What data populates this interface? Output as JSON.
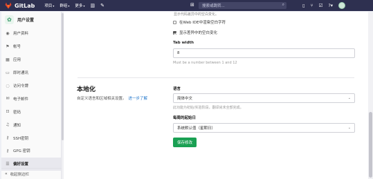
{
  "topbar": {
    "logo_name": "GitLab",
    "nav": [
      {
        "label": "项目",
        "has_caret": true
      },
      {
        "label": "群组",
        "has_caret": true
      },
      {
        "label": "更多",
        "has_caret": true
      }
    ],
    "search_placeholder": "搜索或跳转...",
    "icons": [
      "chart-icon",
      "wrench-icon",
      "plus-icon",
      "search-icon",
      "issues-icon",
      "merge-request-icon",
      "todo-icon",
      "help-icon",
      "avatar"
    ]
  },
  "sidebar": {
    "header": "用户设置",
    "items": [
      {
        "label": "用户资料",
        "icon": "user-icon",
        "active": false
      },
      {
        "label": "帐号",
        "icon": "account-icon",
        "active": false
      },
      {
        "label": "应用",
        "icon": "applications-icon",
        "active": false
      },
      {
        "label": "即时通讯",
        "icon": "chat-icon",
        "active": false
      },
      {
        "label": "访问令牌",
        "icon": "token-icon",
        "active": false
      },
      {
        "label": "电子邮件",
        "icon": "email-icon",
        "active": false
      },
      {
        "label": "密码",
        "icon": "lock-icon",
        "active": false
      },
      {
        "label": "通知",
        "icon": "bell-icon",
        "active": false
      },
      {
        "label": "SSH密钥",
        "icon": "key-icon",
        "active": false
      },
      {
        "label": "GPG 密钥",
        "icon": "gpg-key-icon",
        "active": false
      },
      {
        "label": "偏好设置",
        "icon": "preferences-icon",
        "active": true
      }
    ],
    "collapse_label": "收起侧边栏"
  },
  "content": {
    "cut_text": "显示代码差异中的空白变化。",
    "checkbox_webide": {
      "label": "在Web IDE中渲染空白字符",
      "checked": false
    },
    "checkbox_diff": {
      "label": "显示差异中的空白变化",
      "checked": true
    },
    "tab_width": {
      "label": "Tab width",
      "value": "8",
      "help": "Must be a number between 1 and 12"
    },
    "localization": {
      "title": "本地化",
      "description": "自定义语言和区域相关设置。",
      "learn_more": "进一步了解"
    },
    "language": {
      "label": "语言",
      "value": "简体中文",
      "help": "此功能为初始/实验阶段，翻译尚未全部完成。"
    },
    "first_day": {
      "label": "每周的起始日",
      "value": "系统默认值（星期日）"
    },
    "save_button": "保存修改"
  }
}
